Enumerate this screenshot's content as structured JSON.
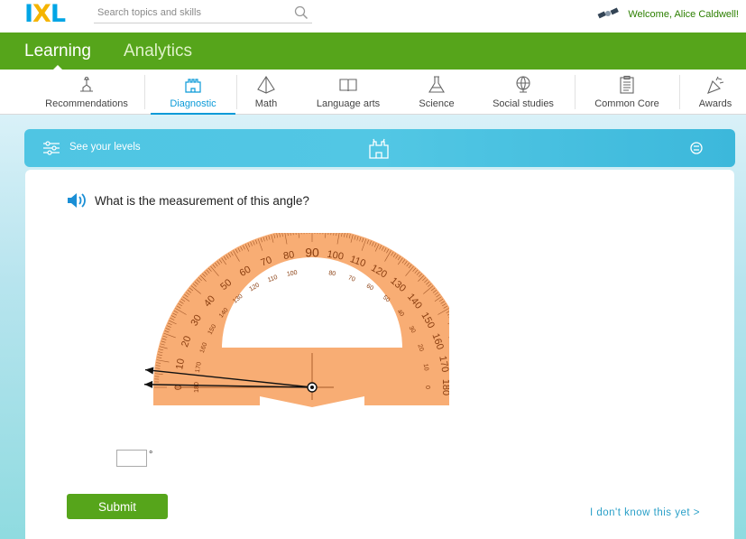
{
  "logo": {
    "part1": "I",
    "part2": "X",
    "part3": "L"
  },
  "search": {
    "placeholder": "Search topics and skills"
  },
  "user": {
    "welcome": "Welcome, Alice Caldwell!"
  },
  "main_nav": {
    "tabs": [
      {
        "label": "Learning",
        "active": true
      },
      {
        "label": "Analytics",
        "active": false
      }
    ]
  },
  "subject_nav": {
    "active_color": "#0a9ad8",
    "items": [
      {
        "label": "Recommendations",
        "icon": "recommendations-icon"
      },
      {
        "label": "Diagnostic",
        "icon": "diagnostic-castle-icon",
        "active": true
      },
      {
        "label": "Math",
        "icon": "pyramid-icon"
      },
      {
        "label": "Language arts",
        "icon": "book-icon"
      },
      {
        "label": "Science",
        "icon": "flask-icon"
      },
      {
        "label": "Social studies",
        "icon": "globe-icon"
      },
      {
        "label": "Common Core",
        "icon": "clipboard-icon"
      },
      {
        "label": "Awards",
        "icon": "party-horn-icon"
      }
    ]
  },
  "levels_banner": {
    "label": "See your levels"
  },
  "question": {
    "text": "What is the measurement of this angle?"
  },
  "protractor": {
    "color": "#f8ad74",
    "outer_labels": [
      "0",
      "10",
      "20",
      "30",
      "40",
      "50",
      "60",
      "70",
      "80",
      "90",
      "100",
      "110",
      "120",
      "130",
      "140",
      "150",
      "160",
      "170",
      "180"
    ],
    "inner_labels": [
      "180",
      "170",
      "160",
      "150",
      "140",
      "130",
      "120",
      "110",
      "100",
      "80",
      "70",
      "60",
      "50",
      "40",
      "30",
      "20",
      "10",
      "0"
    ],
    "ray_angles_deg": [
      174,
      179
    ]
  },
  "answer": {
    "value": "",
    "unit": "°"
  },
  "buttons": {
    "submit": "Submit",
    "dont_know": "I don't know this yet >"
  }
}
